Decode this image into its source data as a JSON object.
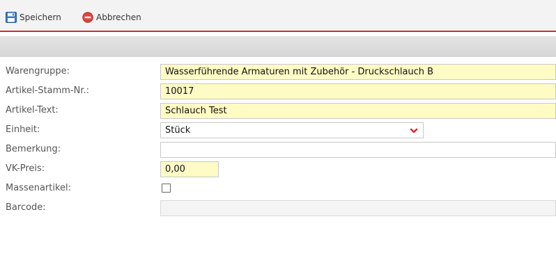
{
  "toolbar": {
    "save_label": "Speichern",
    "cancel_label": "Abbrechen",
    "save_icon": "floppy-disk-icon",
    "cancel_icon": "cancel-circle-icon",
    "accent_color": "#d9262b"
  },
  "form": {
    "warengruppe": {
      "label": "Warengruppe:",
      "value": "Wasserführende Armaturen mit Zubehör - Druckschlauch B"
    },
    "artikel_stamm_nr": {
      "label": "Artikel-Stamm-Nr.:",
      "value": "10017"
    },
    "artikel_text": {
      "label": "Artikel-Text:",
      "value": "Schlauch Test"
    },
    "einheit": {
      "label": "Einheit:",
      "value": "Stück",
      "icon": "chevron-down-icon"
    },
    "bemerkung": {
      "label": "Bemerkung:",
      "value": ""
    },
    "vk_preis": {
      "label": "VK-Preis:",
      "value": "0,00"
    },
    "massenartikel": {
      "label": "Massenartikel:",
      "checked": false
    },
    "barcode": {
      "label": "Barcode:",
      "value": ""
    }
  },
  "colors": {
    "required_field_bg": "#fffbc4",
    "toolbar_bg": "#f3f3f3"
  }
}
